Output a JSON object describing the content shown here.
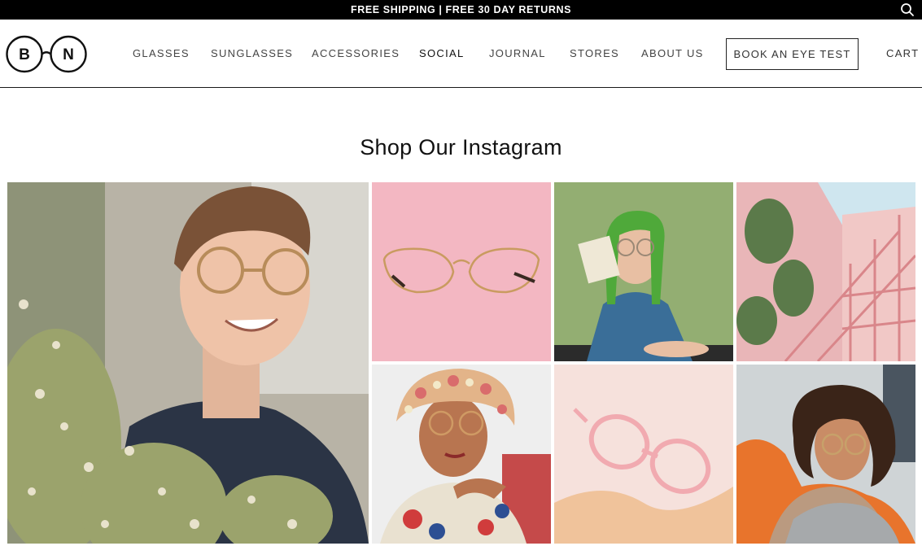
{
  "announcement": {
    "text": "FREE SHIPPING | FREE 30 DAY RETURNS",
    "search_icon": "search-icon"
  },
  "header": {
    "logo": {
      "left_letter": "B",
      "right_letter": "N"
    },
    "nav": [
      {
        "label": "GLASSES"
      },
      {
        "label": "SUNGLASSES"
      },
      {
        "label": "ACCESSORIES"
      },
      {
        "label": "SOCIAL",
        "active": true
      },
      {
        "label": "JOURNAL"
      },
      {
        "label": "STORES"
      },
      {
        "label": "ABOUT US"
      }
    ],
    "cta": "BOOK AN EYE TEST",
    "cart": "CART"
  },
  "instagram": {
    "title": "Shop Our Instagram",
    "tiles": [
      {
        "name": "ig-post-man-in-flowers"
      },
      {
        "name": "ig-post-gold-glasses-pink"
      },
      {
        "name": "ig-post-woman-green-hair"
      },
      {
        "name": "ig-post-pink-staircase"
      },
      {
        "name": "ig-post-woman-floral-hat"
      },
      {
        "name": "ig-post-clear-pink-glasses"
      },
      {
        "name": "ig-post-woman-orange-sweater"
      }
    ]
  },
  "colors": {
    "topbar": "#000000",
    "text": "#222222",
    "pink": "#f2b6c0",
    "green_wall": "#8fa76b",
    "orange": "#e8742c"
  }
}
